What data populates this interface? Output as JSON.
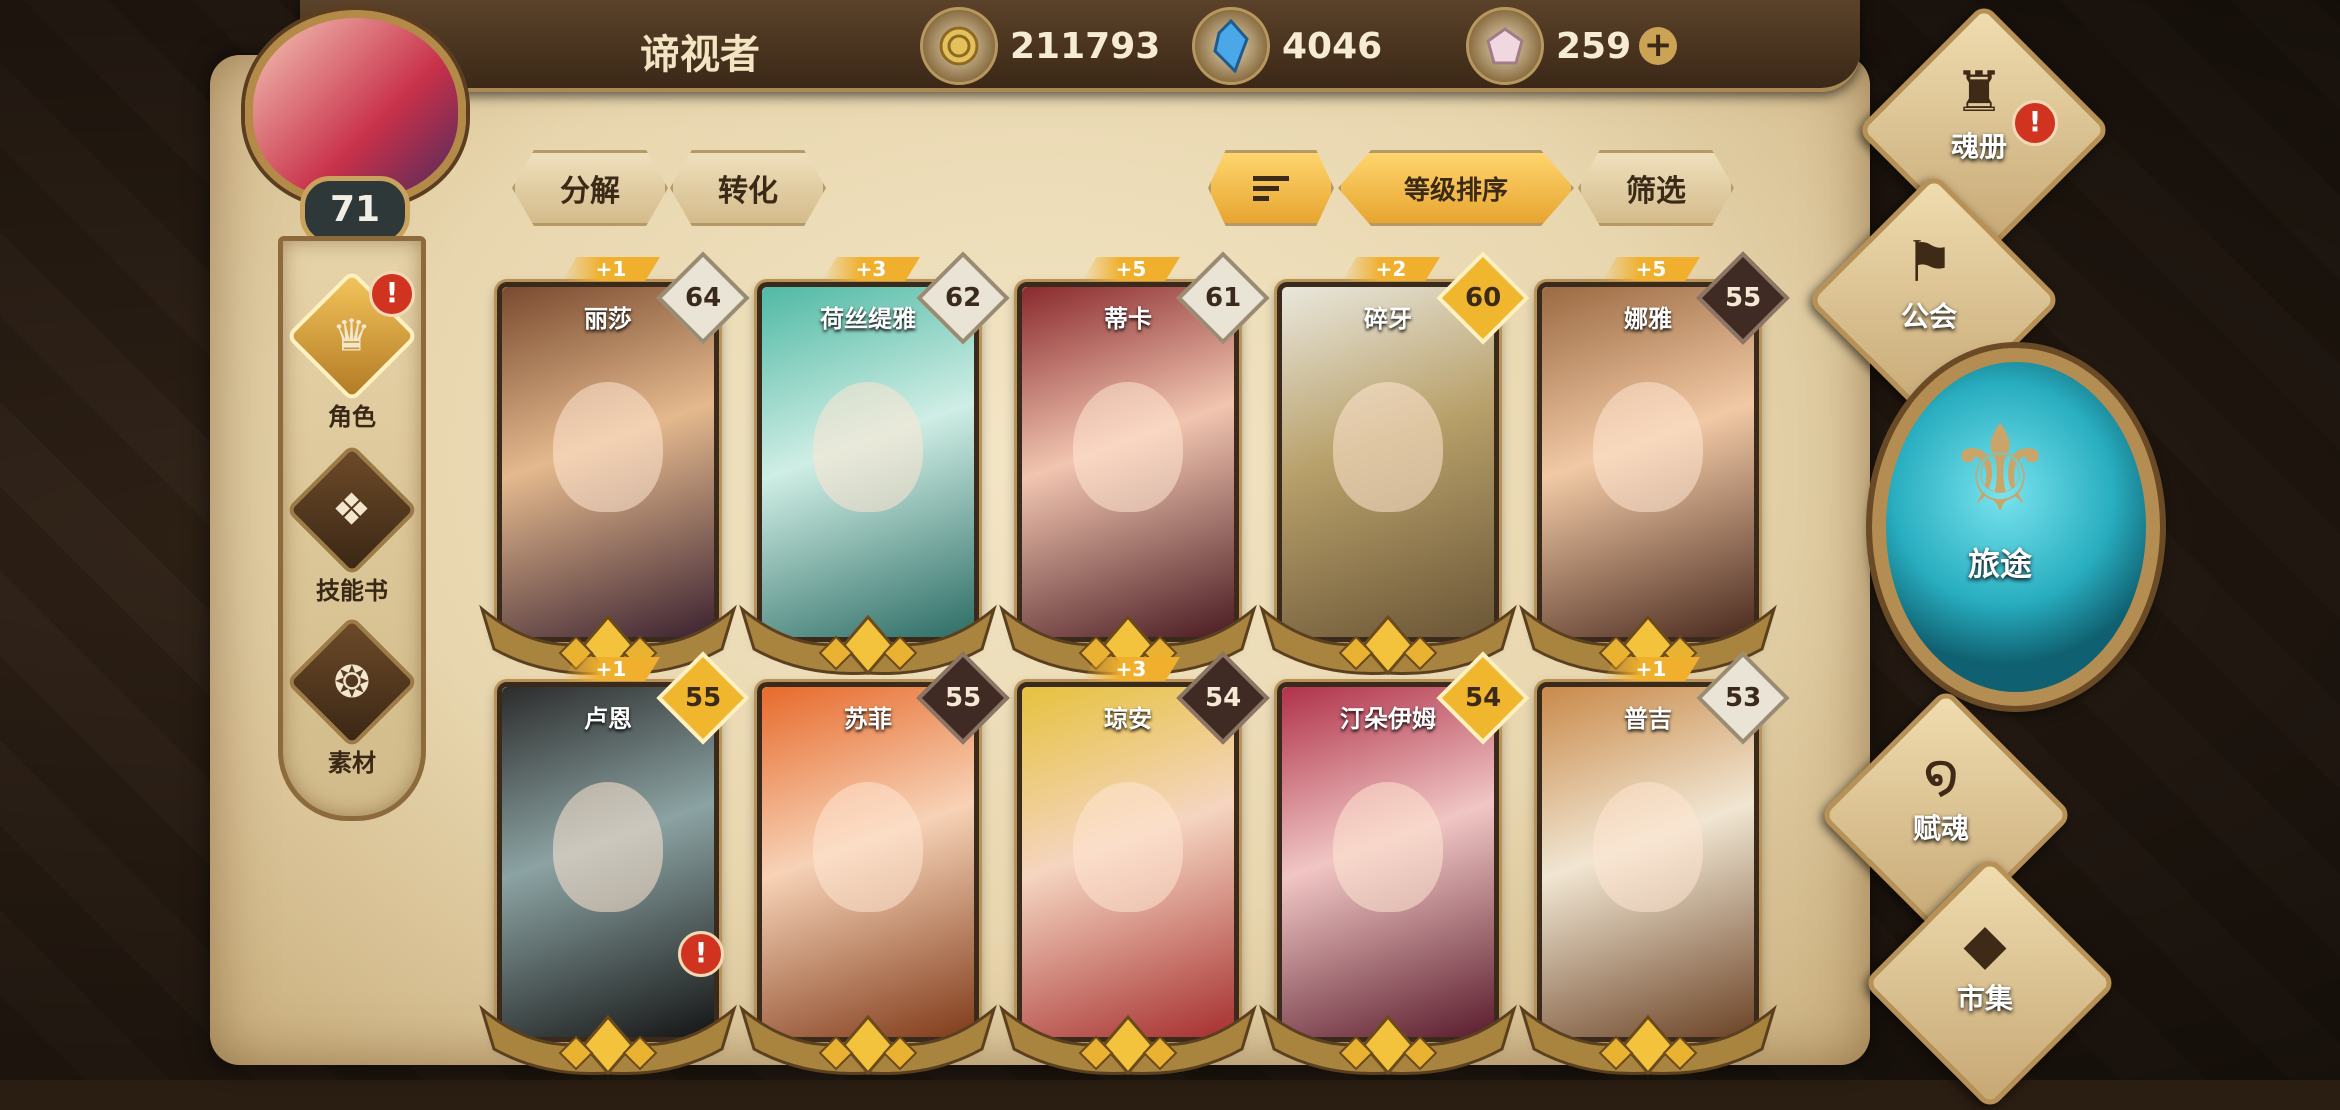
{
  "player": {
    "name": "谛视者",
    "level": "71"
  },
  "currencies": [
    {
      "icon": "gold-coin-icon",
      "value": "211793"
    },
    {
      "icon": "blue-crystal-icon",
      "value": "4046"
    },
    {
      "icon": "pink-gem-icon",
      "value": "259"
    }
  ],
  "plus_symbol": "+",
  "sidebar": [
    {
      "label": "角色",
      "icon": "helmet-icon",
      "glyph": "♛",
      "active": true,
      "alert": "!"
    },
    {
      "label": "技能书",
      "icon": "skill-book-icon",
      "glyph": "❖",
      "active": false
    },
    {
      "label": "素材",
      "icon": "material-icon",
      "glyph": "❂",
      "active": false
    }
  ],
  "actions": {
    "decompose": "分解",
    "convert": "转化",
    "sort_level": "等级排序",
    "filter": "筛选"
  },
  "heroes": [
    {
      "name": "丽莎",
      "level": "64",
      "plus": "+1",
      "badge": "light",
      "colors": [
        "#7a4b2f",
        "#e4b98e",
        "#3b2230"
      ]
    },
    {
      "name": "荷丝缇雅",
      "level": "62",
      "plus": "+3",
      "badge": "light",
      "colors": [
        "#4fb9a4",
        "#cfeee5",
        "#2d6d65"
      ]
    },
    {
      "name": "蒂卡",
      "level": "61",
      "plus": "+5",
      "badge": "light",
      "colors": [
        "#8a2a2e",
        "#f1c5b0",
        "#4a1b22"
      ]
    },
    {
      "name": "碎牙",
      "level": "60",
      "plus": "+2",
      "badge": "gold",
      "colors": [
        "#e9e7dc",
        "#b8a06a",
        "#6a5536"
      ]
    },
    {
      "name": "娜雅",
      "level": "55",
      "plus": "+5",
      "badge": "dark",
      "colors": [
        "#9b6a42",
        "#f1c9a5",
        "#4a2a1f"
      ]
    },
    {
      "name": "卢恩",
      "level": "55",
      "plus": "+1",
      "badge": "gold",
      "colors": [
        "#2c2c2c",
        "#8ca3a3",
        "#151515"
      ],
      "alert": "!"
    },
    {
      "name": "苏菲",
      "level": "55",
      "plus": "",
      "badge": "dark",
      "colors": [
        "#e76a2b",
        "#f7d2b6",
        "#803b1a"
      ]
    },
    {
      "name": "琼安",
      "level": "54",
      "plus": "+3",
      "badge": "dark",
      "colors": [
        "#e6c23e",
        "#f5d5c0",
        "#a62f2f"
      ]
    },
    {
      "name": "汀朵伊姆",
      "level": "54",
      "plus": "",
      "badge": "gold",
      "colors": [
        "#b0324a",
        "#f0c6c4",
        "#5a1c2c"
      ]
    },
    {
      "name": "普吉",
      "level": "53",
      "plus": "+1",
      "badge": "light",
      "colors": [
        "#c98a4a",
        "#f1e6d2",
        "#6b4326"
      ]
    }
  ],
  "right_nav": [
    {
      "label": "魂册",
      "icon": "soul-book-icon",
      "glyph": "♜",
      "alert": "!"
    },
    {
      "label": "公会",
      "icon": "guild-banner-icon",
      "glyph": "⚑"
    },
    {
      "label": "旅途",
      "icon": "journey-emblem-icon",
      "glyph": "⚜"
    },
    {
      "label": "赋魂",
      "icon": "soul-swirl-icon",
      "glyph": "໑"
    },
    {
      "label": "市集",
      "icon": "market-gem-icon",
      "glyph": "◆"
    }
  ],
  "colors": {
    "accent_gold": "#f0b62d",
    "parchment": "#ead9b2",
    "alert_red": "#d0331f",
    "journey_teal": "#28aec0"
  }
}
